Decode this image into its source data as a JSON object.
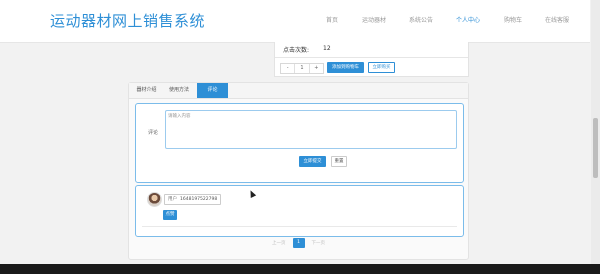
{
  "header": {
    "site_title": "运动器材网上销售系统",
    "nav": [
      {
        "label": "首页",
        "active": false
      },
      {
        "label": "运动器材",
        "active": false
      },
      {
        "label": "系统公告",
        "active": false
      },
      {
        "label": "个人中心",
        "active": true
      },
      {
        "label": "购物车",
        "active": false
      },
      {
        "label": "在线客服",
        "active": false
      }
    ]
  },
  "product": {
    "click_label": "点击次数:",
    "click_value": "12",
    "quantity": "1",
    "minus": "-",
    "plus": "+",
    "add_to_cart": "添加到购物车",
    "buy_now": "立即购买"
  },
  "tabs": [
    {
      "label": "器材介绍",
      "active": false
    },
    {
      "label": "使用方法",
      "active": false
    },
    {
      "label": "评论",
      "active": true
    }
  ],
  "comment_form": {
    "label": "评论",
    "placeholder": "请输入内容",
    "submit": "立即提交",
    "reset": "重置"
  },
  "reviews": [
    {
      "user_label": "用户",
      "user_name": "1648197522798",
      "like_label": "点赞"
    }
  ],
  "pagination": {
    "prev": "上一页",
    "current": "1",
    "next": "下一页"
  },
  "colors": {
    "accent": "#2e8fd6",
    "border_focus": "#7bbcea"
  }
}
